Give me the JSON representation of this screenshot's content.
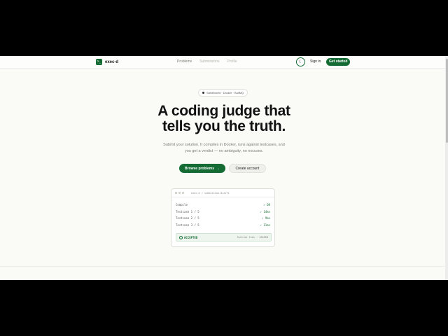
{
  "brand": {
    "logo_glyph": ">_",
    "name": "exec-d"
  },
  "nav": {
    "links": [
      "Problems",
      "Submissions",
      "Profile"
    ],
    "theme_icon": "☾",
    "signin": "Sign in",
    "get_started": "Get started"
  },
  "hero": {
    "badge": "Sandboxed · Docker · BullMQ",
    "headline_line1": "A coding judge that",
    "headline_line2": "tells you the truth.",
    "subtitle_line1": "Submit your solution. It compiles in Docker, runs against testcases, and",
    "subtitle_line2": "you get a verdict — no ambiguity, no excuses.",
    "primary_cta": "Browse problems",
    "primary_cta_arrow": "→",
    "secondary_cta": "Create account"
  },
  "terminal": {
    "title": "exec-d / submission-0×a7f1",
    "rows": [
      {
        "label": "Compile",
        "status": "✓ OK"
      },
      {
        "label": "Testcase 1 / 5",
        "status": "✓ 14ms"
      },
      {
        "label": "Testcase 2 / 5",
        "status": "✓ 9ms"
      },
      {
        "label": "Testcase 3 / 5",
        "status": "✓ 11ms"
      }
    ],
    "verdict": "ACCEPTED",
    "verdict_meta": "Runtime 11ms · 3848KB"
  },
  "colors": {
    "accent": "#146c34",
    "background": "#fafaf7",
    "text": "#121212"
  }
}
